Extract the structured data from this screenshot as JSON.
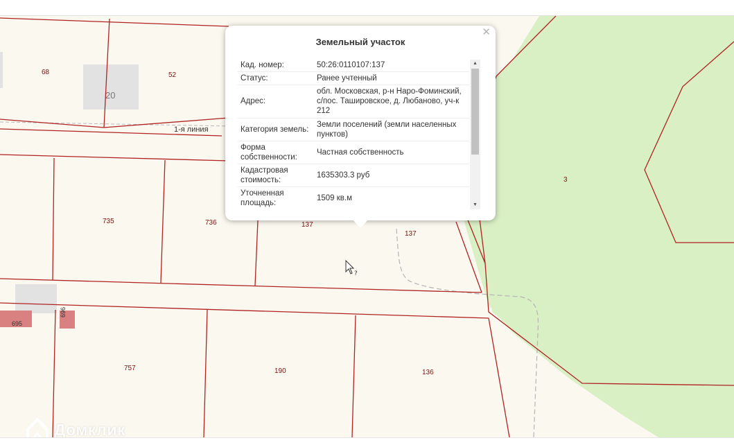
{
  "map": {
    "plot_labels": [
      "68",
      "52",
      "735",
      "736",
      "137",
      "137",
      "3",
      "757",
      "190",
      "136"
    ],
    "small_plot_labels": [
      "695",
      "696"
    ],
    "building_label": "20",
    "street_label": "1-я линия",
    "colors": {
      "background": "#fbf9ef",
      "boundary": "#b02222",
      "forest": "#d9efc4",
      "building": "#e2e2e2",
      "small_plot": "#d98080"
    }
  },
  "popup": {
    "title": "Земельный участок",
    "close_icon": "close-icon",
    "rows": [
      {
        "key": "Кад. номер:",
        "value": "50:26:0110107:137"
      },
      {
        "key": "Статус:",
        "value": "Ранее учтенный"
      },
      {
        "key": "Адрес:",
        "value": "обл. Московская, р-н Наро-Фоминский, с/пос. Ташировское, д. Любаново, уч-к 212"
      },
      {
        "key": "Категория земель:",
        "value": "Земли поселений (земли населенных пунктов)"
      },
      {
        "key": "Форма собственности:",
        "value": "Частная собственность"
      },
      {
        "key": "Кадастровая стоимость:",
        "value": "1635303.3 руб"
      },
      {
        "key": "Уточненная площадь:",
        "value": "1509 кв.м"
      }
    ]
  },
  "watermark": {
    "icon": "house-logo-icon",
    "text": "Домклик"
  }
}
